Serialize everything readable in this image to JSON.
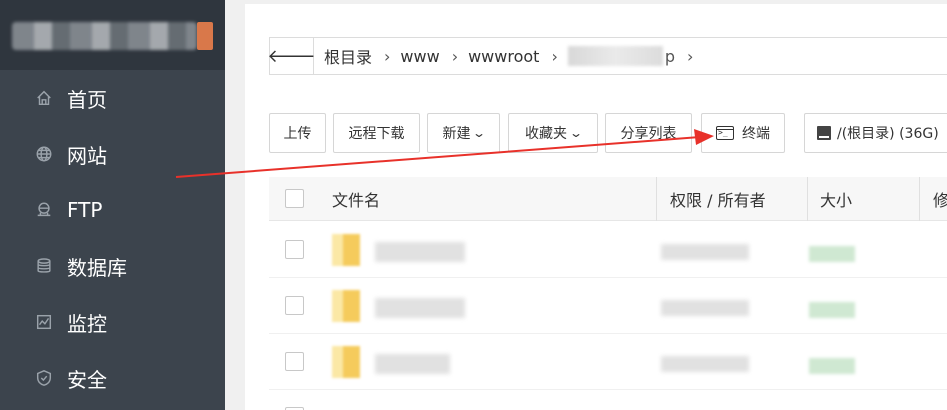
{
  "sidebar": {
    "items": [
      {
        "label": "首页",
        "icon": "home-icon"
      },
      {
        "label": "网站",
        "icon": "globe-icon"
      },
      {
        "label": "FTP",
        "icon": "ftp-icon"
      },
      {
        "label": "数据库",
        "icon": "database-icon"
      },
      {
        "label": "监控",
        "icon": "monitor-icon"
      },
      {
        "label": "安全",
        "icon": "shield-icon"
      }
    ]
  },
  "breadcrumb": {
    "back_icon": "arrow-left-icon",
    "items": [
      "根目录",
      "www",
      "wwwroot"
    ],
    "tail": "p"
  },
  "toolbar": {
    "upload": "上传",
    "remote_download": "远程下载",
    "new": "新建",
    "favorites": "收藏夹",
    "share_list": "分享列表",
    "terminal": "终端",
    "disk": "/(根目录) (36G)"
  },
  "table": {
    "headers": {
      "name": "文件名",
      "permission": "权限 / 所有者",
      "size": "大小",
      "modified": "修"
    }
  },
  "colors": {
    "sidebar_bg": "#3c444d",
    "accent": "#d9784a",
    "arrow": "#e8312a"
  }
}
